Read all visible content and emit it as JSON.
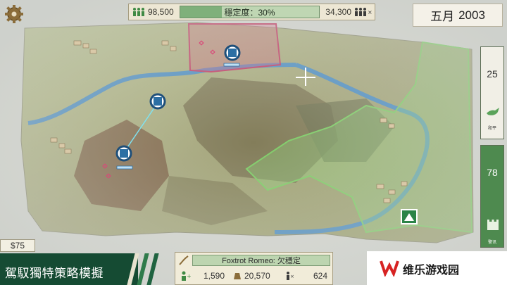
{
  "topbar": {
    "left_population": "98,500",
    "stability_label": "穩定度：30%",
    "stability_value": 0.3,
    "right_population": "34,300"
  },
  "date": {
    "month": "五月",
    "year": "2003"
  },
  "side_meter_top": {
    "value": "25",
    "caption": "和平"
  },
  "side_meter_bottom": {
    "value": "78",
    "caption": "警讯"
  },
  "money": "$75",
  "banner": {
    "text": "駕馭獨特策略模擬"
  },
  "unit_panel": {
    "unit_name": "Foxtrot Romeo: 欠穩定",
    "stat_troops": "1,590",
    "stat_money": "20,570",
    "stat_casualties": "624"
  },
  "watermark": {
    "text": "维乐游戏园"
  },
  "colors": {
    "accent_green": "#4e8a4f",
    "enemy_zone": "#d7557a",
    "friendly_zone": "#8fd77a",
    "banner": "#154b33"
  },
  "icons": [
    "gear-icon",
    "population-icon",
    "stability-bar",
    "unit-marker-icon",
    "drone-icon",
    "dove-icon",
    "fortress-icon",
    "camp-icon",
    "wheat-icon"
  ]
}
